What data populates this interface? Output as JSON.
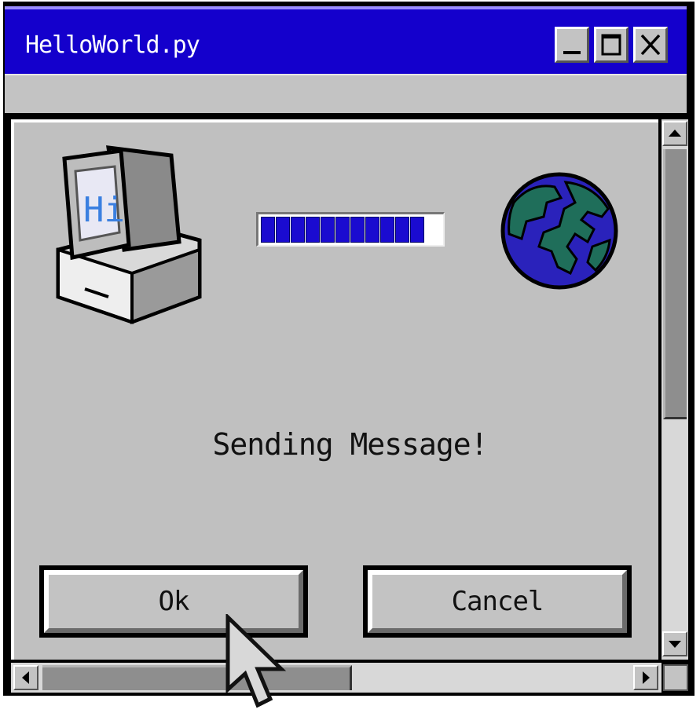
{
  "window": {
    "title": "HelloWorld.py",
    "title_buttons": [
      {
        "name": "minimize",
        "icon": "minimize-icon"
      },
      {
        "name": "maximize",
        "icon": "maximize-icon"
      },
      {
        "name": "close",
        "icon": "close-icon"
      }
    ]
  },
  "dialog": {
    "computer_screen_text": "Hi",
    "message": "Sending Message!",
    "progress_percent": 100,
    "progress_segments": 11,
    "ok_label": "Ok",
    "cancel_label": "Cancel"
  },
  "icons": {
    "left": "computer-icon",
    "right": "globe-icon",
    "pointer": "mouse-cursor-icon"
  },
  "colors": {
    "titlebar": "#1400cc",
    "progress": "#1a0bd0",
    "globe_ocean": "#2a22bb",
    "globe_land": "#1f6e5a",
    "window_face": "#c0c0c0"
  }
}
